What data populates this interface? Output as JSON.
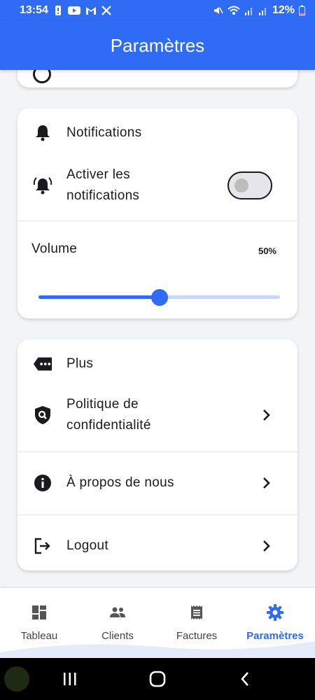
{
  "status": {
    "time": "13:54",
    "battery": "12%"
  },
  "app_bar": {
    "title": "Paramètres"
  },
  "notifications": {
    "header": "Notifications",
    "enable_label_line1": "Activer les",
    "enable_label_line2": "notifications",
    "enabled": false,
    "volume_label": "Volume",
    "volume_value": "50%",
    "volume_level": 0.5
  },
  "more": {
    "header": "Plus",
    "privacy_line1": "Politique de",
    "privacy_line2": "confidentialité",
    "about": "À propos de nous",
    "logout": "Logout"
  },
  "bottom_nav": {
    "items": [
      {
        "label": "Tableau",
        "icon": "dashboard-icon",
        "active": false
      },
      {
        "label": "Clients",
        "icon": "people-icon",
        "active": false
      },
      {
        "label": "Factures",
        "icon": "receipt-icon",
        "active": false
      },
      {
        "label": "Paramètres",
        "icon": "settings-icon",
        "active": true
      }
    ]
  },
  "colors": {
    "primary": "#2f6bf5",
    "background": "#f3f4f6",
    "text": "#1b1b1f"
  }
}
